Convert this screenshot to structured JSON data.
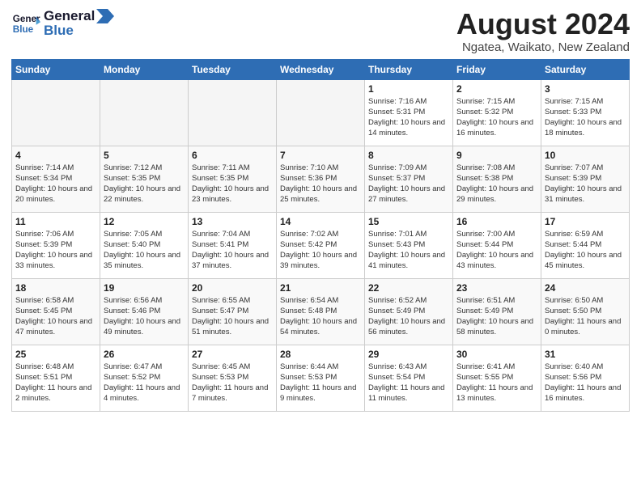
{
  "header": {
    "logo_line1": "General",
    "logo_line2": "Blue",
    "month_year": "August 2024",
    "location": "Ngatea, Waikato, New Zealand"
  },
  "weekdays": [
    "Sunday",
    "Monday",
    "Tuesday",
    "Wednesday",
    "Thursday",
    "Friday",
    "Saturday"
  ],
  "weeks": [
    [
      {
        "day": "",
        "empty": true
      },
      {
        "day": "",
        "empty": true
      },
      {
        "day": "",
        "empty": true
      },
      {
        "day": "",
        "empty": true
      },
      {
        "day": "1",
        "sunrise": "7:16 AM",
        "sunset": "5:31 PM",
        "daylight": "10 hours and 14 minutes."
      },
      {
        "day": "2",
        "sunrise": "7:15 AM",
        "sunset": "5:32 PM",
        "daylight": "10 hours and 16 minutes."
      },
      {
        "day": "3",
        "sunrise": "7:15 AM",
        "sunset": "5:33 PM",
        "daylight": "10 hours and 18 minutes."
      }
    ],
    [
      {
        "day": "4",
        "sunrise": "7:14 AM",
        "sunset": "5:34 PM",
        "daylight": "10 hours and 20 minutes."
      },
      {
        "day": "5",
        "sunrise": "7:12 AM",
        "sunset": "5:35 PM",
        "daylight": "10 hours and 22 minutes."
      },
      {
        "day": "6",
        "sunrise": "7:11 AM",
        "sunset": "5:35 PM",
        "daylight": "10 hours and 23 minutes."
      },
      {
        "day": "7",
        "sunrise": "7:10 AM",
        "sunset": "5:36 PM",
        "daylight": "10 hours and 25 minutes."
      },
      {
        "day": "8",
        "sunrise": "7:09 AM",
        "sunset": "5:37 PM",
        "daylight": "10 hours and 27 minutes."
      },
      {
        "day": "9",
        "sunrise": "7:08 AM",
        "sunset": "5:38 PM",
        "daylight": "10 hours and 29 minutes."
      },
      {
        "day": "10",
        "sunrise": "7:07 AM",
        "sunset": "5:39 PM",
        "daylight": "10 hours and 31 minutes."
      }
    ],
    [
      {
        "day": "11",
        "sunrise": "7:06 AM",
        "sunset": "5:39 PM",
        "daylight": "10 hours and 33 minutes."
      },
      {
        "day": "12",
        "sunrise": "7:05 AM",
        "sunset": "5:40 PM",
        "daylight": "10 hours and 35 minutes."
      },
      {
        "day": "13",
        "sunrise": "7:04 AM",
        "sunset": "5:41 PM",
        "daylight": "10 hours and 37 minutes."
      },
      {
        "day": "14",
        "sunrise": "7:02 AM",
        "sunset": "5:42 PM",
        "daylight": "10 hours and 39 minutes."
      },
      {
        "day": "15",
        "sunrise": "7:01 AM",
        "sunset": "5:43 PM",
        "daylight": "10 hours and 41 minutes."
      },
      {
        "day": "16",
        "sunrise": "7:00 AM",
        "sunset": "5:44 PM",
        "daylight": "10 hours and 43 minutes."
      },
      {
        "day": "17",
        "sunrise": "6:59 AM",
        "sunset": "5:44 PM",
        "daylight": "10 hours and 45 minutes."
      }
    ],
    [
      {
        "day": "18",
        "sunrise": "6:58 AM",
        "sunset": "5:45 PM",
        "daylight": "10 hours and 47 minutes."
      },
      {
        "day": "19",
        "sunrise": "6:56 AM",
        "sunset": "5:46 PM",
        "daylight": "10 hours and 49 minutes."
      },
      {
        "day": "20",
        "sunrise": "6:55 AM",
        "sunset": "5:47 PM",
        "daylight": "10 hours and 51 minutes."
      },
      {
        "day": "21",
        "sunrise": "6:54 AM",
        "sunset": "5:48 PM",
        "daylight": "10 hours and 54 minutes."
      },
      {
        "day": "22",
        "sunrise": "6:52 AM",
        "sunset": "5:49 PM",
        "daylight": "10 hours and 56 minutes."
      },
      {
        "day": "23",
        "sunrise": "6:51 AM",
        "sunset": "5:49 PM",
        "daylight": "10 hours and 58 minutes."
      },
      {
        "day": "24",
        "sunrise": "6:50 AM",
        "sunset": "5:50 PM",
        "daylight": "11 hours and 0 minutes."
      }
    ],
    [
      {
        "day": "25",
        "sunrise": "6:48 AM",
        "sunset": "5:51 PM",
        "daylight": "11 hours and 2 minutes."
      },
      {
        "day": "26",
        "sunrise": "6:47 AM",
        "sunset": "5:52 PM",
        "daylight": "11 hours and 4 minutes."
      },
      {
        "day": "27",
        "sunrise": "6:45 AM",
        "sunset": "5:53 PM",
        "daylight": "11 hours and 7 minutes."
      },
      {
        "day": "28",
        "sunrise": "6:44 AM",
        "sunset": "5:53 PM",
        "daylight": "11 hours and 9 minutes."
      },
      {
        "day": "29",
        "sunrise": "6:43 AM",
        "sunset": "5:54 PM",
        "daylight": "11 hours and 11 minutes."
      },
      {
        "day": "30",
        "sunrise": "6:41 AM",
        "sunset": "5:55 PM",
        "daylight": "11 hours and 13 minutes."
      },
      {
        "day": "31",
        "sunrise": "6:40 AM",
        "sunset": "5:56 PM",
        "daylight": "11 hours and 16 minutes."
      }
    ]
  ]
}
